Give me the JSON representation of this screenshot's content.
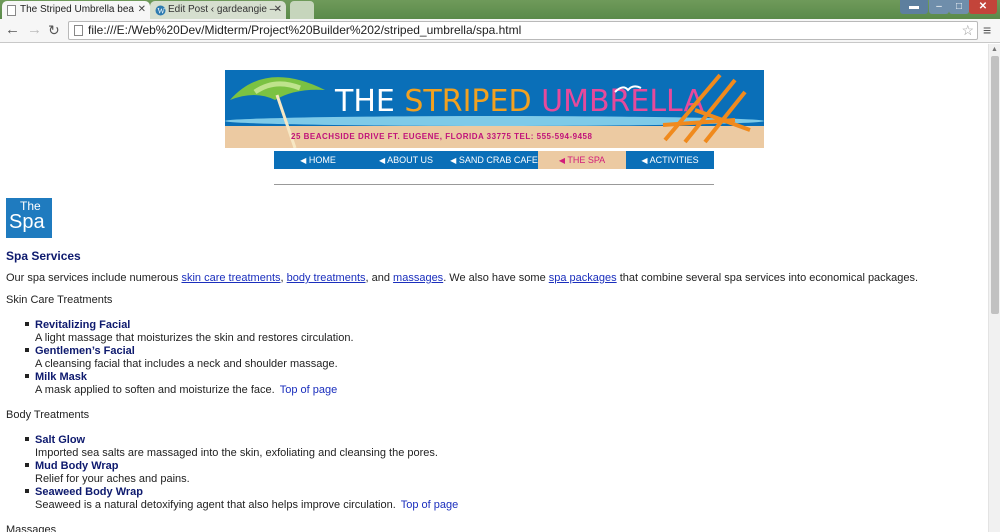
{
  "browser": {
    "tabs": [
      {
        "title": "The Striped Umbrella bea",
        "active": true
      },
      {
        "title": "Edit Post ‹ gardeangie —",
        "active": false
      }
    ],
    "url": "file:///E:/Web%20Dev/Midterm/Project%20Builder%202/striped_umbrella/spa.html"
  },
  "banner": {
    "title_part1": "THE ",
    "title_part2": "STRIPED ",
    "title_part3": "UMBRELLA",
    "address": "25 BEACHSIDE DRIVE   FT. EUGENE, FLORIDA 33775   TEL: 555-594-9458"
  },
  "nav": [
    {
      "label": "HOME"
    },
    {
      "label": "ABOUT US"
    },
    {
      "label": "SAND CRAB CAFE"
    },
    {
      "label": "THE SPA"
    },
    {
      "label": "ACTIVITIES"
    }
  ],
  "spa_logo": {
    "line1": "The",
    "line2": "Spa"
  },
  "page": {
    "heading": "Spa Services",
    "intro": {
      "t1": "Our spa services include numerous ",
      "link1": "skin care treatments",
      "t2": ", ",
      "link2": "body treatments",
      "t3": ", and ",
      "link3": "massages",
      "t4": ". We also have some ",
      "link4": "spa packages",
      "t5": " that combine several spa services into economical packages."
    },
    "sections": [
      {
        "title": "Skin Care Treatments",
        "items": [
          {
            "name": "Revitalizing Facial",
            "desc": "A light massage that moisturizes the skin and restores circulation."
          },
          {
            "name": "Gentlemen’s Facial",
            "desc": "A cleansing facial that includes a neck and shoulder massage."
          },
          {
            "name": "Milk Mask",
            "desc": "A mask applied to soften and moisturize the face."
          }
        ],
        "top_link": "Top of page"
      },
      {
        "title": "Body Treatments",
        "items": [
          {
            "name": "Salt Glow",
            "desc": "Imported sea salts are massaged into the skin, exfoliating and cleansing the pores."
          },
          {
            "name": "Mud Body Wrap",
            "desc": "Relief for your aches and pains."
          },
          {
            "name": "Seaweed Body Wrap",
            "desc": "Seaweed is a natural detoxifying agent that also helps improve circulation."
          }
        ],
        "top_link": "Top of page"
      },
      {
        "title": "Massages",
        "items": [],
        "top_link": ""
      }
    ]
  }
}
